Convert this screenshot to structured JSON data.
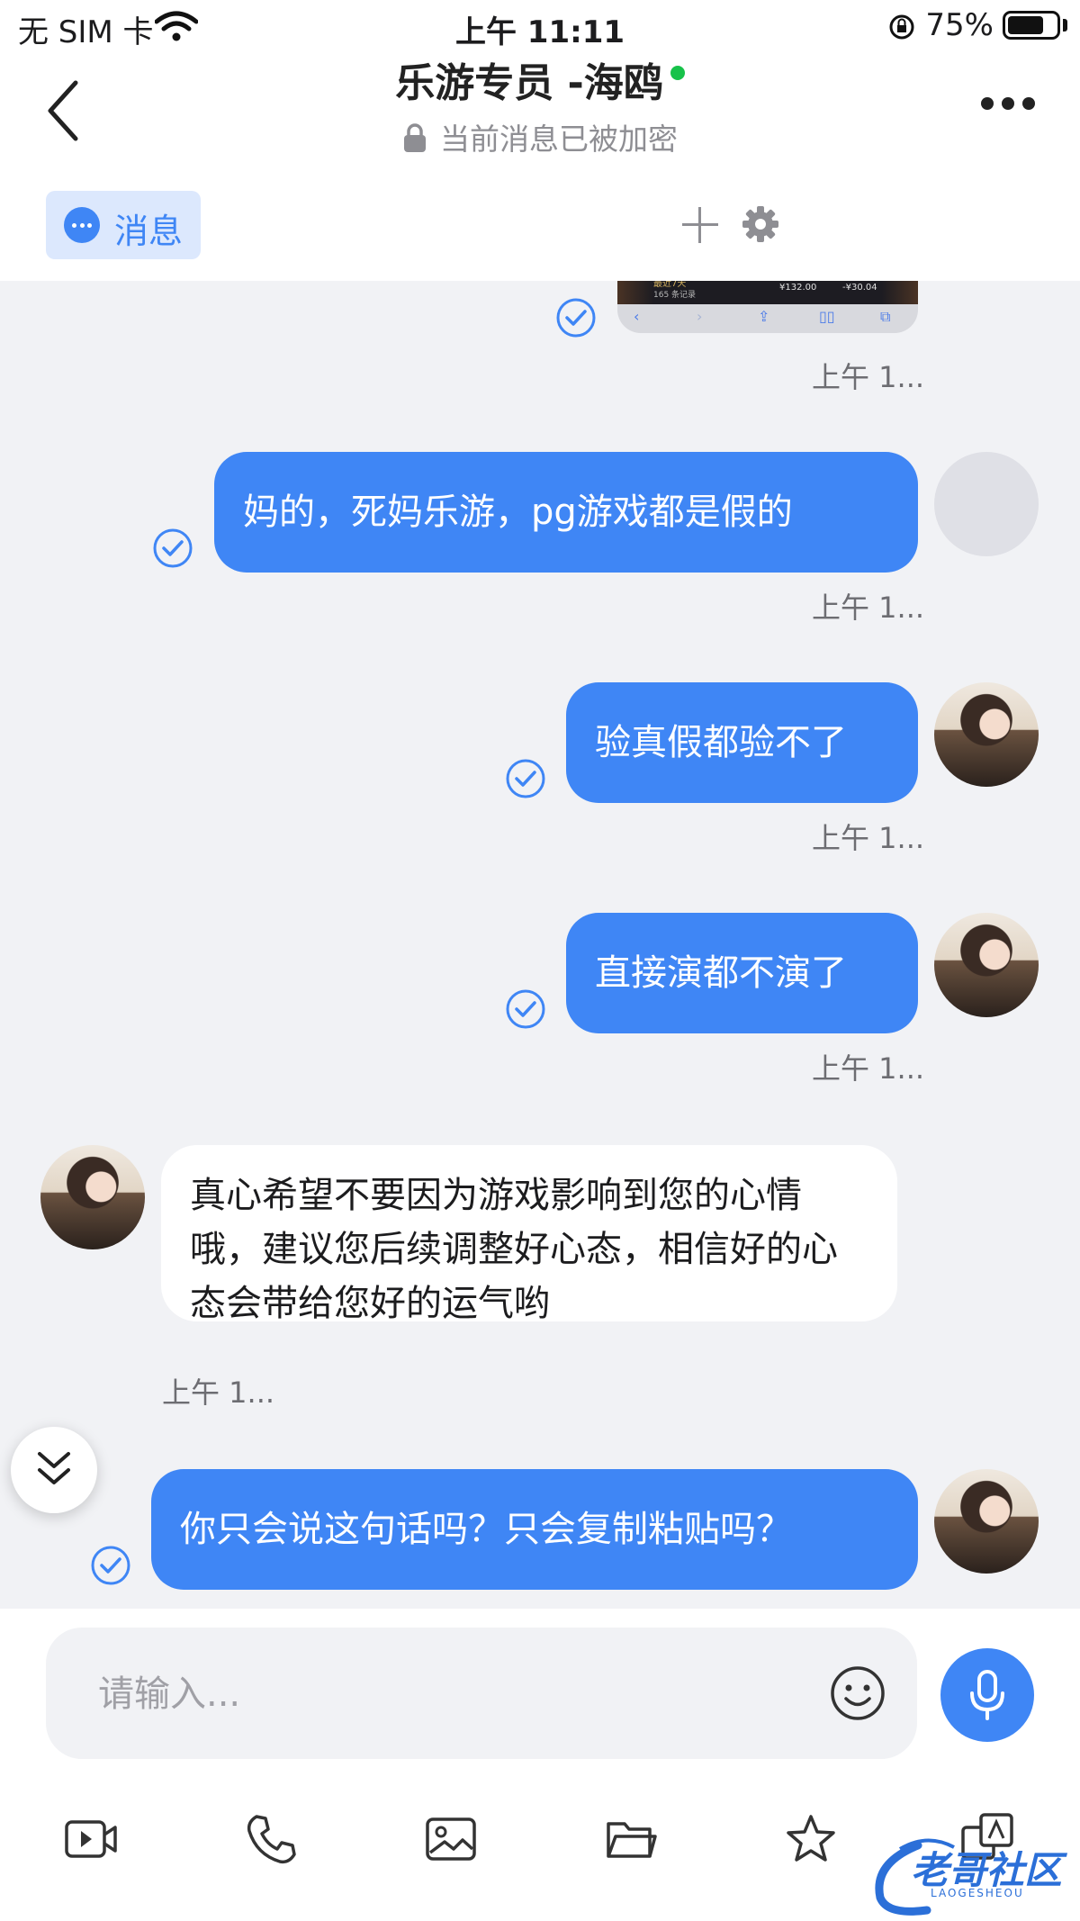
{
  "status_bar": {
    "carrier": "无 SIM 卡",
    "time": "上午 11:11",
    "battery": "75%",
    "battery_level": 0.75
  },
  "header": {
    "title": "乐游专员 -海鸥",
    "encryption_note": "当前消息已被加密",
    "online": true
  },
  "tabs": {
    "message_label": "消息"
  },
  "thumbnail": {
    "line1": "最近7天",
    "line2": "165 条记录",
    "amount1": "¥132.00",
    "amount2": "-¥30.04"
  },
  "messages": [
    {
      "dir": "out",
      "text": "妈的，死妈乐游，pg游戏都是假的",
      "time": "上午 1..."
    },
    {
      "dir": "out",
      "text": "验真假都验不了",
      "time": "上午 1..."
    },
    {
      "dir": "out",
      "text": "直接演都不演了",
      "time": "上午 1..."
    },
    {
      "dir": "in",
      "text": "真心希望不要因为游戏影响到您的心情哦，建议您后续调整好心态，相信好的心态会带给您好的运气哟",
      "time": "上午 1..."
    },
    {
      "dir": "out",
      "text": "你只会说这句话吗？只会复制粘贴吗？",
      "time": ""
    }
  ],
  "first_time": "上午 1...",
  "input": {
    "placeholder": "请输入..."
  },
  "watermark": {
    "text": "老哥社区",
    "sub": "LAOGESHEOU"
  },
  "colors": {
    "accent": "#3f86f5",
    "chat_bg": "#f1f2f5",
    "online": "#17c24a"
  }
}
